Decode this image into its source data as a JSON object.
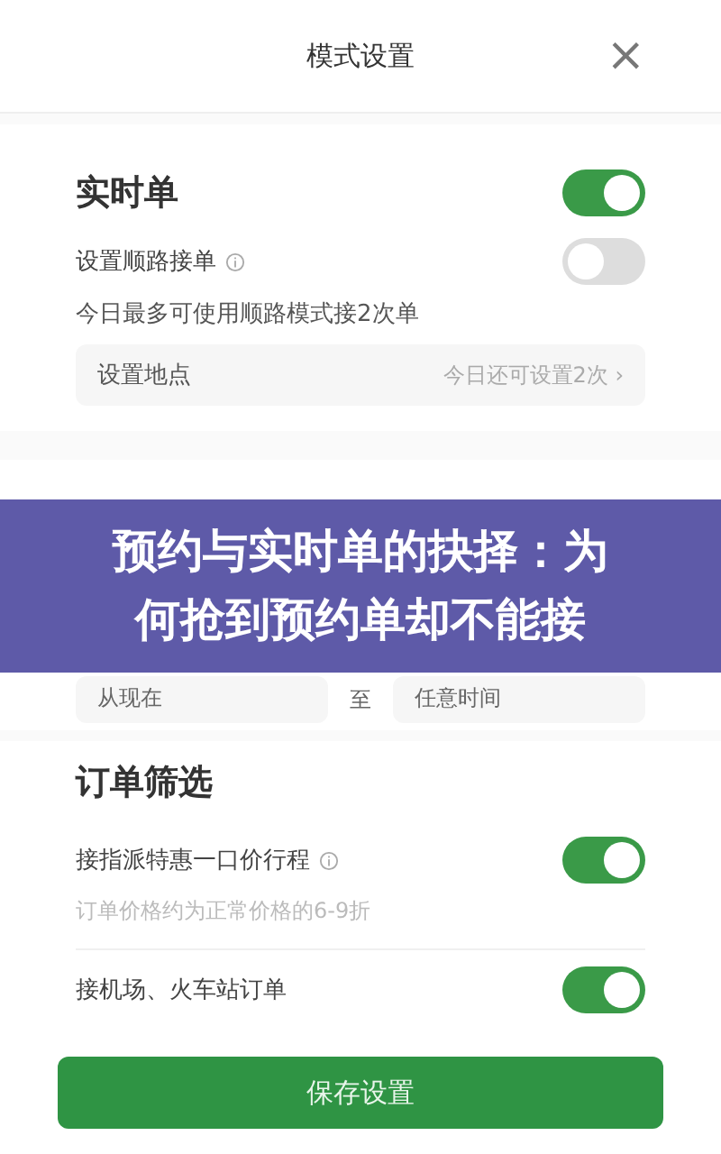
{
  "header": {
    "title": "模式设置",
    "close": "×"
  },
  "realtime": {
    "title": "实时单",
    "on": true,
    "rows": [
      {
        "label": "设置顺路接单",
        "info": true,
        "on": false
      }
    ],
    "note": "今日最多可使用顺路模式接2次单",
    "location": {
      "label": "设置地点",
      "value": "今日还可设置2次",
      "chevron": "›"
    }
  },
  "reserve": {
    "from": "从现在",
    "sep": "至",
    "to": "任意时间"
  },
  "banner": "预约与实时单的抉择：为何抢到预约单却不能接",
  "filter": {
    "title": "订单筛选",
    "rows": [
      {
        "label": "接指派特惠一口价行程",
        "info": true,
        "on": true,
        "note": "订单价格约为正常价格的6-9折"
      },
      {
        "label": "接机场、火车站订单",
        "info": false,
        "on": true
      }
    ]
  },
  "save": "保存设置"
}
